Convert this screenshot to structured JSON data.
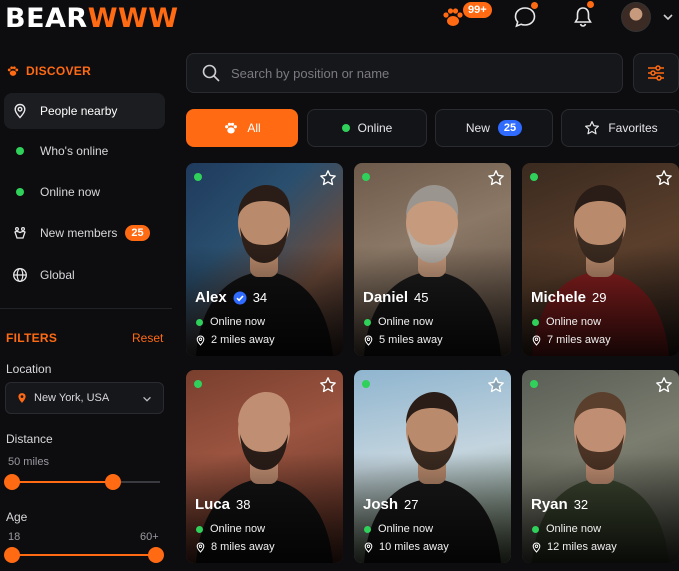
{
  "app": {
    "logo_part1": "BEAR",
    "logo_part2": "WWW",
    "paw_badge": "99+",
    "accent": "#ff6a13",
    "online_color": "#2fd15a"
  },
  "sidebar": {
    "discover_title": "DISCOVER",
    "items": [
      {
        "label": "People nearby",
        "icon": "location-pin-icon"
      },
      {
        "label": "Who's online",
        "icon": "online-dot-icon"
      },
      {
        "label": "Online now",
        "icon": "online-dot-icon"
      },
      {
        "label": "New members",
        "icon": "bear-paw-outline-icon",
        "badge": "25"
      },
      {
        "label": "Global",
        "icon": "globe-icon"
      }
    ],
    "filters_title": "FILTERS",
    "reset_label": "Reset",
    "location_label": "Location",
    "location_value": "New York, USA",
    "distance_label": "Distance",
    "distance_value": "50 miles",
    "distance_fraction": 0.68,
    "age_label": "Age",
    "age_min": "18",
    "age_max": "60+",
    "age_range_fraction": [
      0,
      1
    ]
  },
  "search": {
    "placeholder": "Search by position or name"
  },
  "tabs": [
    {
      "label": "All",
      "icon": "paw-icon"
    },
    {
      "label": "Online",
      "icon": "online-dot-icon"
    },
    {
      "label": "New",
      "badge": "25"
    },
    {
      "label": "Favorites",
      "icon": "star-icon"
    }
  ],
  "profiles": [
    {
      "name": "Alex",
      "age": "34",
      "verified": true,
      "status": "Online now",
      "distance": "2 miles away"
    },
    {
      "name": "Daniel",
      "age": "45",
      "verified": false,
      "status": "Online now",
      "distance": "5 miles away"
    },
    {
      "name": "Michele",
      "age": "29",
      "verified": false,
      "status": "Online now",
      "distance": "7 miles away"
    },
    {
      "name": "Luca",
      "age": "38",
      "verified": false,
      "status": "Online now",
      "distance": "8 miles away"
    },
    {
      "name": "Josh",
      "age": "27",
      "verified": false,
      "status": "Online now",
      "distance": "10 miles away"
    },
    {
      "name": "Ryan",
      "age": "32",
      "verified": false,
      "status": "Online now",
      "distance": "12 miles away"
    }
  ]
}
